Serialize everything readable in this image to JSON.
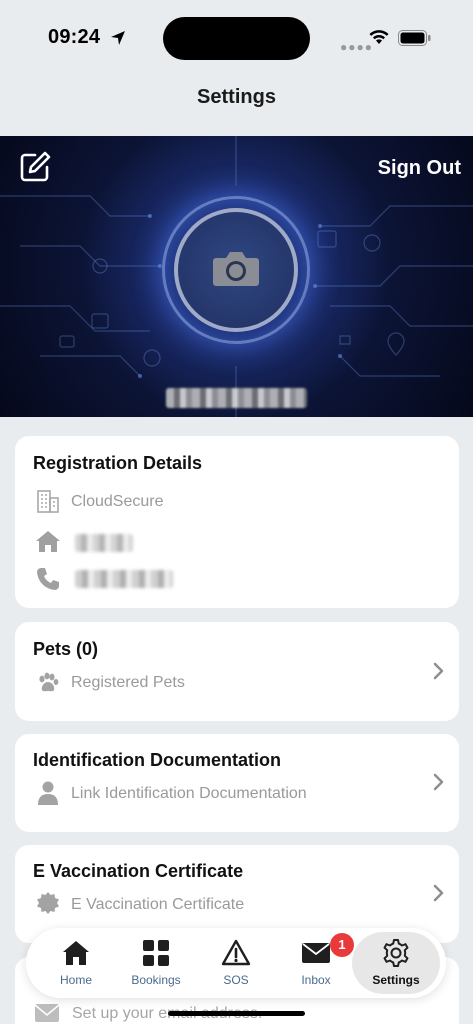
{
  "status_bar": {
    "time": "09:24"
  },
  "header": {
    "title": "Settings"
  },
  "profile": {
    "sign_out_label": "Sign Out"
  },
  "registration": {
    "title": "Registration Details",
    "company": "CloudSecure"
  },
  "pets": {
    "title": "Pets (0)",
    "subtitle": "Registered Pets"
  },
  "identification": {
    "title": "Identification Documentation",
    "subtitle": "Link Identification Documentation"
  },
  "vaccination": {
    "title": "E Vaccination Certificate",
    "subtitle": "E Vaccination Certificate"
  },
  "email_row": {
    "subtitle": "Set up your email address."
  },
  "tabs": [
    {
      "label": "Home",
      "icon": "home-icon"
    },
    {
      "label": "Bookings",
      "icon": "grid-icon"
    },
    {
      "label": "SOS",
      "icon": "warning-icon"
    },
    {
      "label": "Inbox",
      "icon": "mail-icon",
      "badge": "1"
    },
    {
      "label": "Settings",
      "icon": "gear-icon",
      "active": true
    }
  ],
  "colors": {
    "background": "#e9ecef",
    "badge": "#e83a3a",
    "tab_label": "#4a6b8c"
  }
}
